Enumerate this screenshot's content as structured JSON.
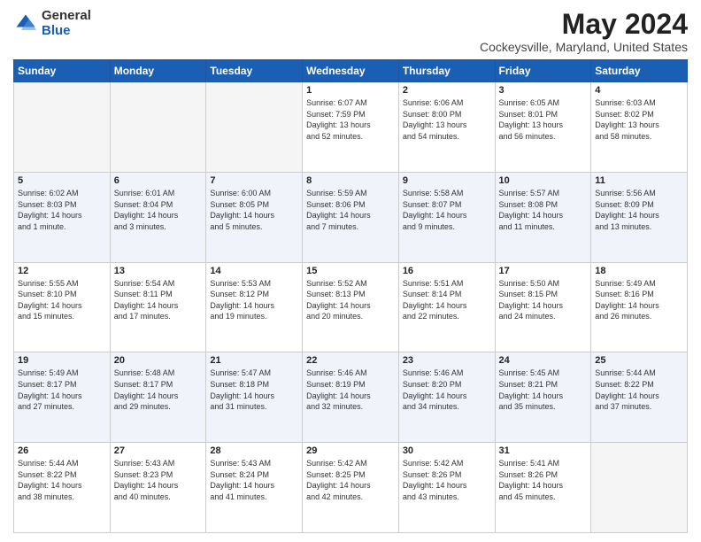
{
  "header": {
    "logo_general": "General",
    "logo_blue": "Blue",
    "title": "May 2024",
    "subtitle": "Cockeysville, Maryland, United States"
  },
  "weekdays": [
    "Sunday",
    "Monday",
    "Tuesday",
    "Wednesday",
    "Thursday",
    "Friday",
    "Saturday"
  ],
  "weeks": [
    [
      {
        "day": "",
        "empty": true
      },
      {
        "day": "",
        "empty": true
      },
      {
        "day": "",
        "empty": true
      },
      {
        "day": "1",
        "info": "Sunrise: 6:07 AM\nSunset: 7:59 PM\nDaylight: 13 hours\nand 52 minutes."
      },
      {
        "day": "2",
        "info": "Sunrise: 6:06 AM\nSunset: 8:00 PM\nDaylight: 13 hours\nand 54 minutes."
      },
      {
        "day": "3",
        "info": "Sunrise: 6:05 AM\nSunset: 8:01 PM\nDaylight: 13 hours\nand 56 minutes."
      },
      {
        "day": "4",
        "info": "Sunrise: 6:03 AM\nSunset: 8:02 PM\nDaylight: 13 hours\nand 58 minutes."
      }
    ],
    [
      {
        "day": "5",
        "info": "Sunrise: 6:02 AM\nSunset: 8:03 PM\nDaylight: 14 hours\nand 1 minute."
      },
      {
        "day": "6",
        "info": "Sunrise: 6:01 AM\nSunset: 8:04 PM\nDaylight: 14 hours\nand 3 minutes."
      },
      {
        "day": "7",
        "info": "Sunrise: 6:00 AM\nSunset: 8:05 PM\nDaylight: 14 hours\nand 5 minutes."
      },
      {
        "day": "8",
        "info": "Sunrise: 5:59 AM\nSunset: 8:06 PM\nDaylight: 14 hours\nand 7 minutes."
      },
      {
        "day": "9",
        "info": "Sunrise: 5:58 AM\nSunset: 8:07 PM\nDaylight: 14 hours\nand 9 minutes."
      },
      {
        "day": "10",
        "info": "Sunrise: 5:57 AM\nSunset: 8:08 PM\nDaylight: 14 hours\nand 11 minutes."
      },
      {
        "day": "11",
        "info": "Sunrise: 5:56 AM\nSunset: 8:09 PM\nDaylight: 14 hours\nand 13 minutes."
      }
    ],
    [
      {
        "day": "12",
        "info": "Sunrise: 5:55 AM\nSunset: 8:10 PM\nDaylight: 14 hours\nand 15 minutes."
      },
      {
        "day": "13",
        "info": "Sunrise: 5:54 AM\nSunset: 8:11 PM\nDaylight: 14 hours\nand 17 minutes."
      },
      {
        "day": "14",
        "info": "Sunrise: 5:53 AM\nSunset: 8:12 PM\nDaylight: 14 hours\nand 19 minutes."
      },
      {
        "day": "15",
        "info": "Sunrise: 5:52 AM\nSunset: 8:13 PM\nDaylight: 14 hours\nand 20 minutes."
      },
      {
        "day": "16",
        "info": "Sunrise: 5:51 AM\nSunset: 8:14 PM\nDaylight: 14 hours\nand 22 minutes."
      },
      {
        "day": "17",
        "info": "Sunrise: 5:50 AM\nSunset: 8:15 PM\nDaylight: 14 hours\nand 24 minutes."
      },
      {
        "day": "18",
        "info": "Sunrise: 5:49 AM\nSunset: 8:16 PM\nDaylight: 14 hours\nand 26 minutes."
      }
    ],
    [
      {
        "day": "19",
        "info": "Sunrise: 5:49 AM\nSunset: 8:17 PM\nDaylight: 14 hours\nand 27 minutes."
      },
      {
        "day": "20",
        "info": "Sunrise: 5:48 AM\nSunset: 8:17 PM\nDaylight: 14 hours\nand 29 minutes."
      },
      {
        "day": "21",
        "info": "Sunrise: 5:47 AM\nSunset: 8:18 PM\nDaylight: 14 hours\nand 31 minutes."
      },
      {
        "day": "22",
        "info": "Sunrise: 5:46 AM\nSunset: 8:19 PM\nDaylight: 14 hours\nand 32 minutes."
      },
      {
        "day": "23",
        "info": "Sunrise: 5:46 AM\nSunset: 8:20 PM\nDaylight: 14 hours\nand 34 minutes."
      },
      {
        "day": "24",
        "info": "Sunrise: 5:45 AM\nSunset: 8:21 PM\nDaylight: 14 hours\nand 35 minutes."
      },
      {
        "day": "25",
        "info": "Sunrise: 5:44 AM\nSunset: 8:22 PM\nDaylight: 14 hours\nand 37 minutes."
      }
    ],
    [
      {
        "day": "26",
        "info": "Sunrise: 5:44 AM\nSunset: 8:22 PM\nDaylight: 14 hours\nand 38 minutes."
      },
      {
        "day": "27",
        "info": "Sunrise: 5:43 AM\nSunset: 8:23 PM\nDaylight: 14 hours\nand 40 minutes."
      },
      {
        "day": "28",
        "info": "Sunrise: 5:43 AM\nSunset: 8:24 PM\nDaylight: 14 hours\nand 41 minutes."
      },
      {
        "day": "29",
        "info": "Sunrise: 5:42 AM\nSunset: 8:25 PM\nDaylight: 14 hours\nand 42 minutes."
      },
      {
        "day": "30",
        "info": "Sunrise: 5:42 AM\nSunset: 8:26 PM\nDaylight: 14 hours\nand 43 minutes."
      },
      {
        "day": "31",
        "info": "Sunrise: 5:41 AM\nSunset: 8:26 PM\nDaylight: 14 hours\nand 45 minutes."
      },
      {
        "day": "",
        "empty": true
      }
    ]
  ]
}
